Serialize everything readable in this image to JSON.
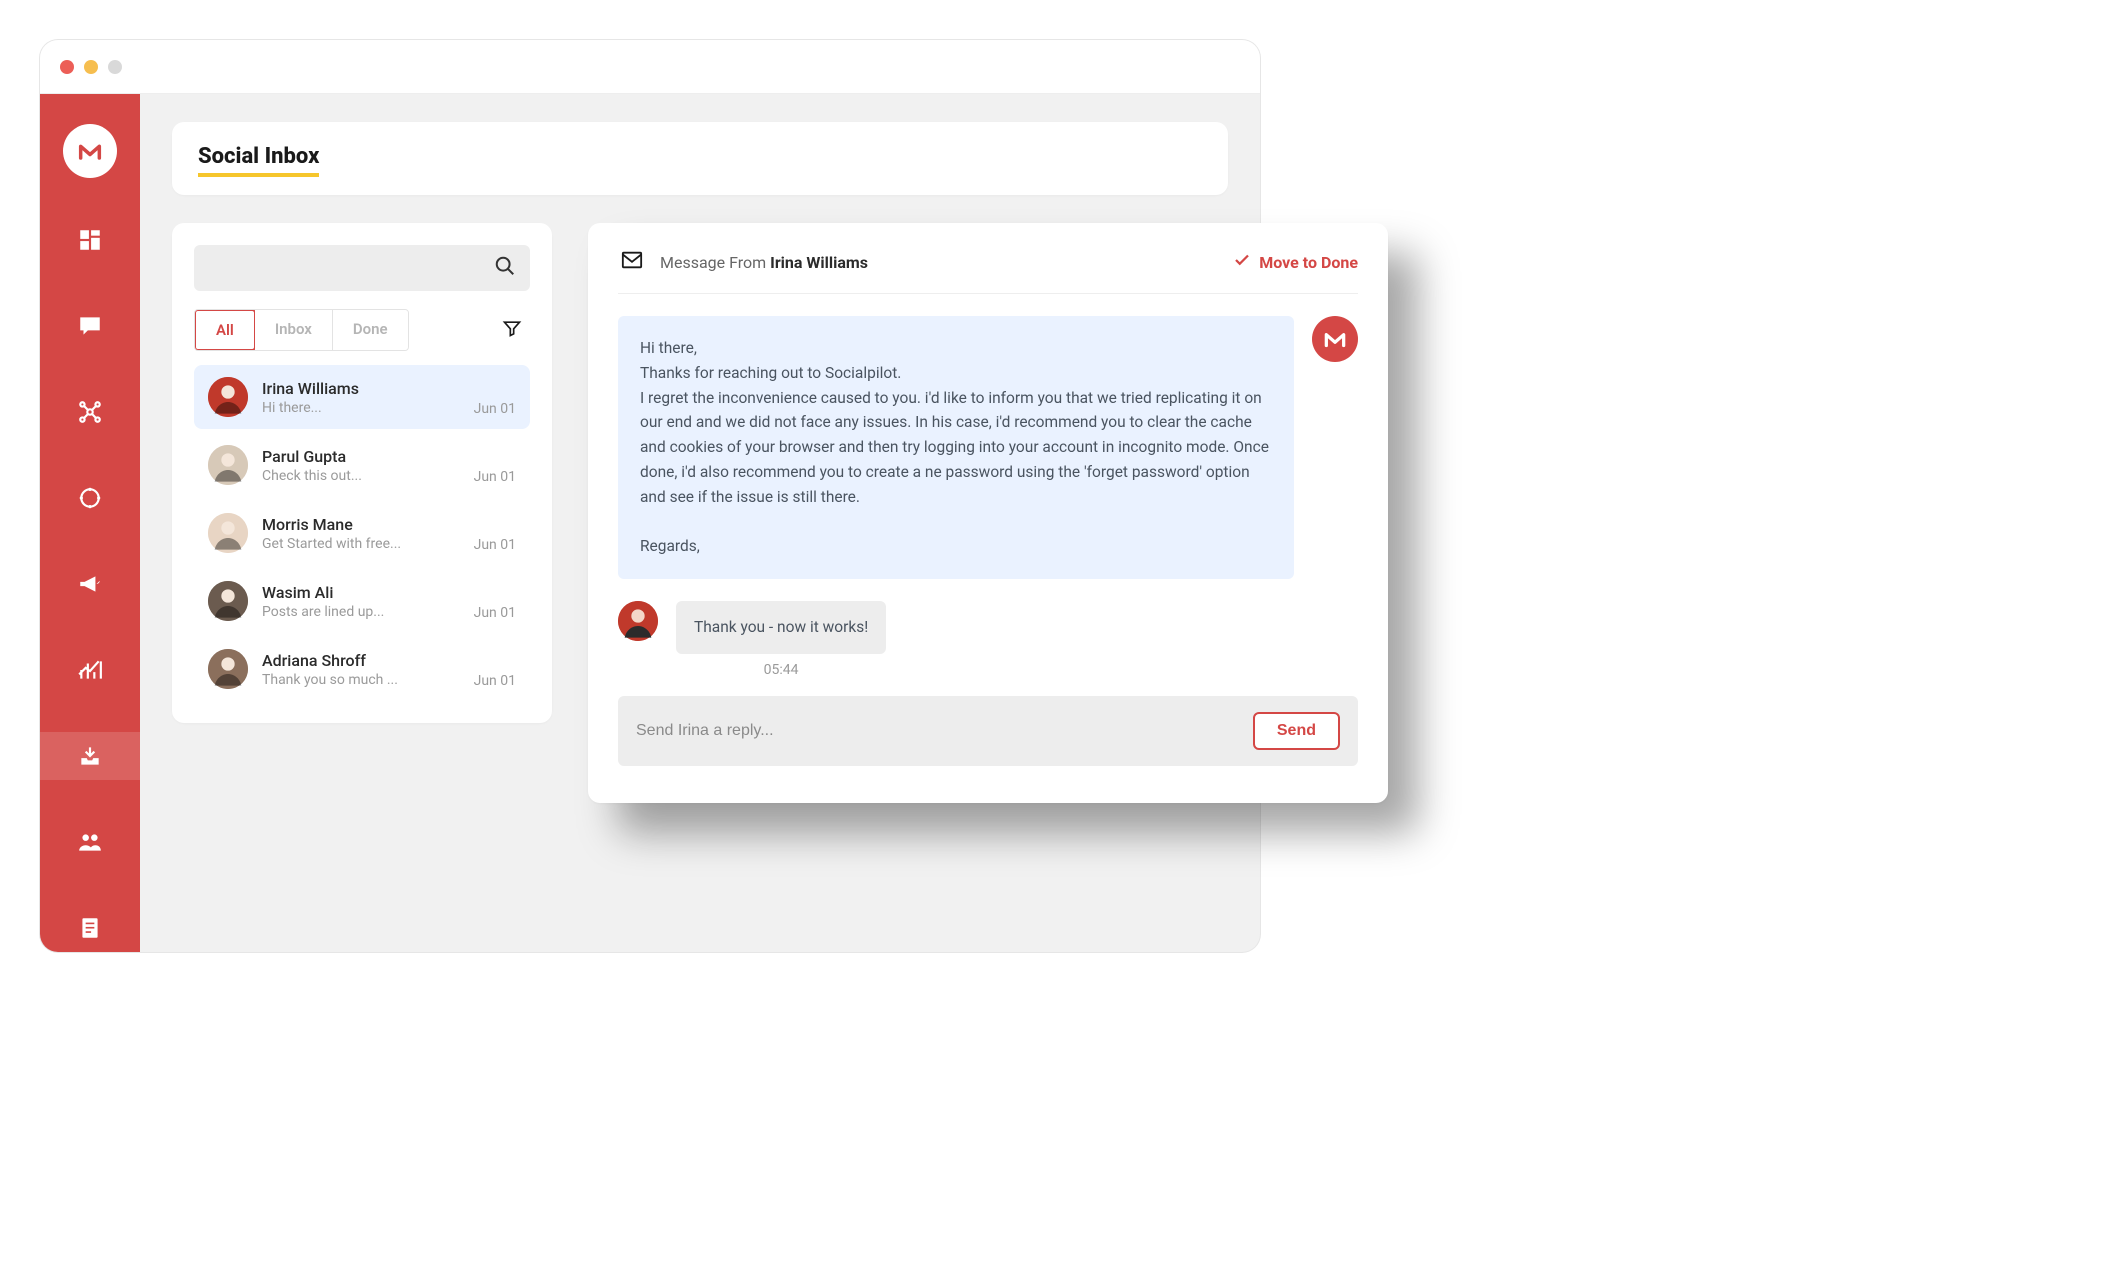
{
  "header": {
    "title": "Social Inbox"
  },
  "tabs": {
    "all": "All",
    "inbox": "Inbox",
    "done": "Done"
  },
  "conversations": [
    {
      "name": "Irina Williams",
      "preview": "Hi there...",
      "date": "Jun 01",
      "avatar_bg": "#c0392b"
    },
    {
      "name": "Parul Gupta",
      "preview": "Check this out...",
      "date": "Jun 01",
      "avatar_bg": "#d7c9b8"
    },
    {
      "name": "Morris Mane",
      "preview": "Get Started with free...",
      "date": "Jun 01",
      "avatar_bg": "#e8d5c4"
    },
    {
      "name": "Wasim Ali",
      "preview": "Posts are lined up...",
      "date": "Jun 01",
      "avatar_bg": "#6b5b4f"
    },
    {
      "name": "Adriana Shroff",
      "preview": "Thank you so much ...",
      "date": "Jun 01",
      "avatar_bg": "#8b6f5c"
    }
  ],
  "detail": {
    "from_prefix": "Message From ",
    "from_name": "Irina Williams",
    "move_done": "Move to Done",
    "agent_message": "Hi there,\nThanks for reaching out to Socialpilot.\nI regret the inconvenience caused to you. i'd like to inform you that we tried replicating it on our end and we did not face any issues. In his case, i'd recommend you to clear the cache and cookies of your browser and then try logging into your account in incognito mode. Once done, i'd also recommend you to create a ne password using the 'forget password' option and see if the issue is still there.\n\nRegards,",
    "user_message": "Thank you - now it works!",
    "user_time": "05:44",
    "reply_placeholder": "Send Irina a reply...",
    "send_label": "Send"
  }
}
